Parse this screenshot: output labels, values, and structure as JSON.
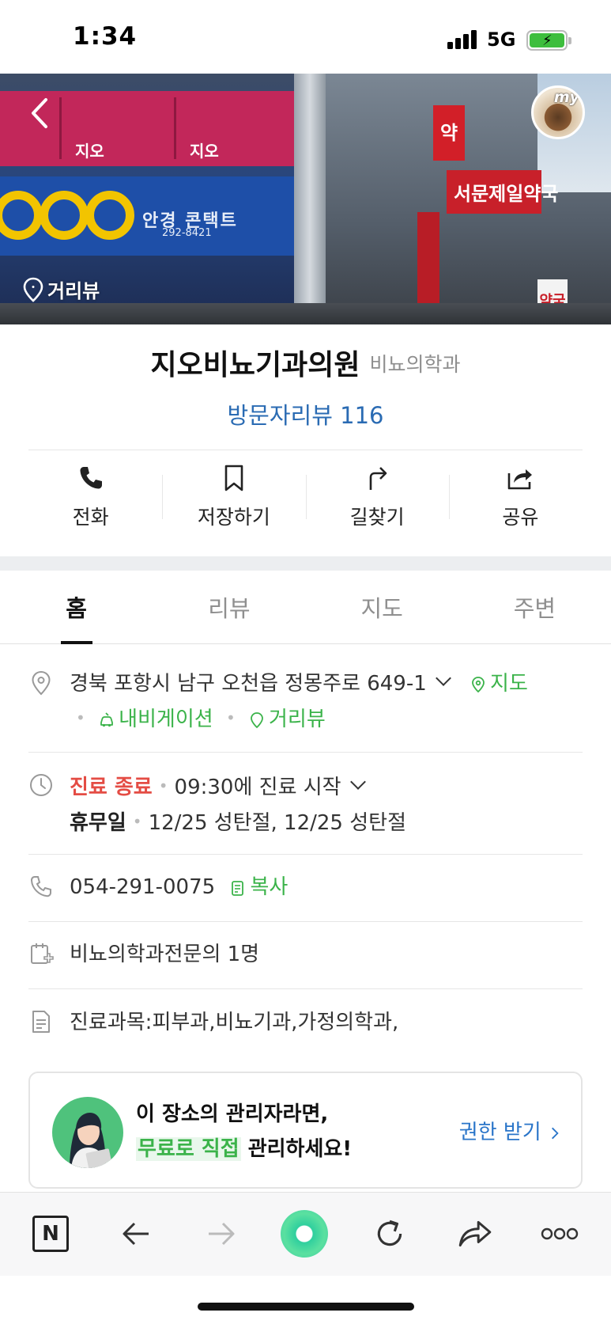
{
  "status_bar": {
    "time": "1:34",
    "network": "5G",
    "battery_level": 0.85,
    "battery_charging": true
  },
  "hero": {
    "streetview_label": "거리뷰",
    "my_badge_label": "my",
    "photo_sign_texts": {
      "store_name_1": "지오",
      "store_name_2": "지오",
      "contact_lens": "안경 콘택트",
      "contact_phone": "292-8421",
      "pharmacy_big": "서문제일약국",
      "pharmacy_char": "약",
      "pharmacy_small": "약국"
    }
  },
  "place": {
    "name": "지오비뇨기과의원",
    "category": "비뇨의학과",
    "review_link": "방문자리뷰 116"
  },
  "actions": [
    {
      "label": "전화",
      "icon": "phone-icon"
    },
    {
      "label": "저장하기",
      "icon": "bookmark-icon"
    },
    {
      "label": "길찾기",
      "icon": "directions-icon"
    },
    {
      "label": "공유",
      "icon": "share-icon"
    }
  ],
  "tabs": [
    {
      "label": "홈",
      "active": true
    },
    {
      "label": "리뷰",
      "active": false
    },
    {
      "label": "지도",
      "active": false
    },
    {
      "label": "주변",
      "active": false
    }
  ],
  "info": {
    "address": "경북 포항시 남구 오천읍 정몽주로 649-1",
    "map_link": "지도",
    "navigation_link": "내비게이션",
    "streetview_link": "거리뷰",
    "hours_status": "진료 종료",
    "hours_next": "09:30에 진료 시작",
    "holiday_label": "휴무일",
    "holiday_detail": "12/25 성탄절, 12/25 성탄절",
    "phone": "054-291-0075",
    "copy_label": "복사",
    "specialists": "비뇨의학과전문의 1명",
    "departments": "진료과목:피부과,비뇨기과,가정의학과,"
  },
  "admin_banner": {
    "line1": "이 장소의 관리자라면,",
    "line2_highlight": "무료로 직접",
    "line2_rest": " 관리하세요!",
    "link": "권한 받기"
  },
  "browser_bar": {
    "home_label": "N",
    "icons": [
      "naver-home-icon",
      "back-arrow-icon",
      "forward-arrow-icon",
      "green-dot-icon",
      "refresh-icon",
      "share-arrow-icon",
      "more-icon"
    ]
  },
  "colors": {
    "link_blue": "#2a6bb3",
    "green": "#3bb34a",
    "closed_red": "#e44c44",
    "divider": "#e6e6e6"
  }
}
